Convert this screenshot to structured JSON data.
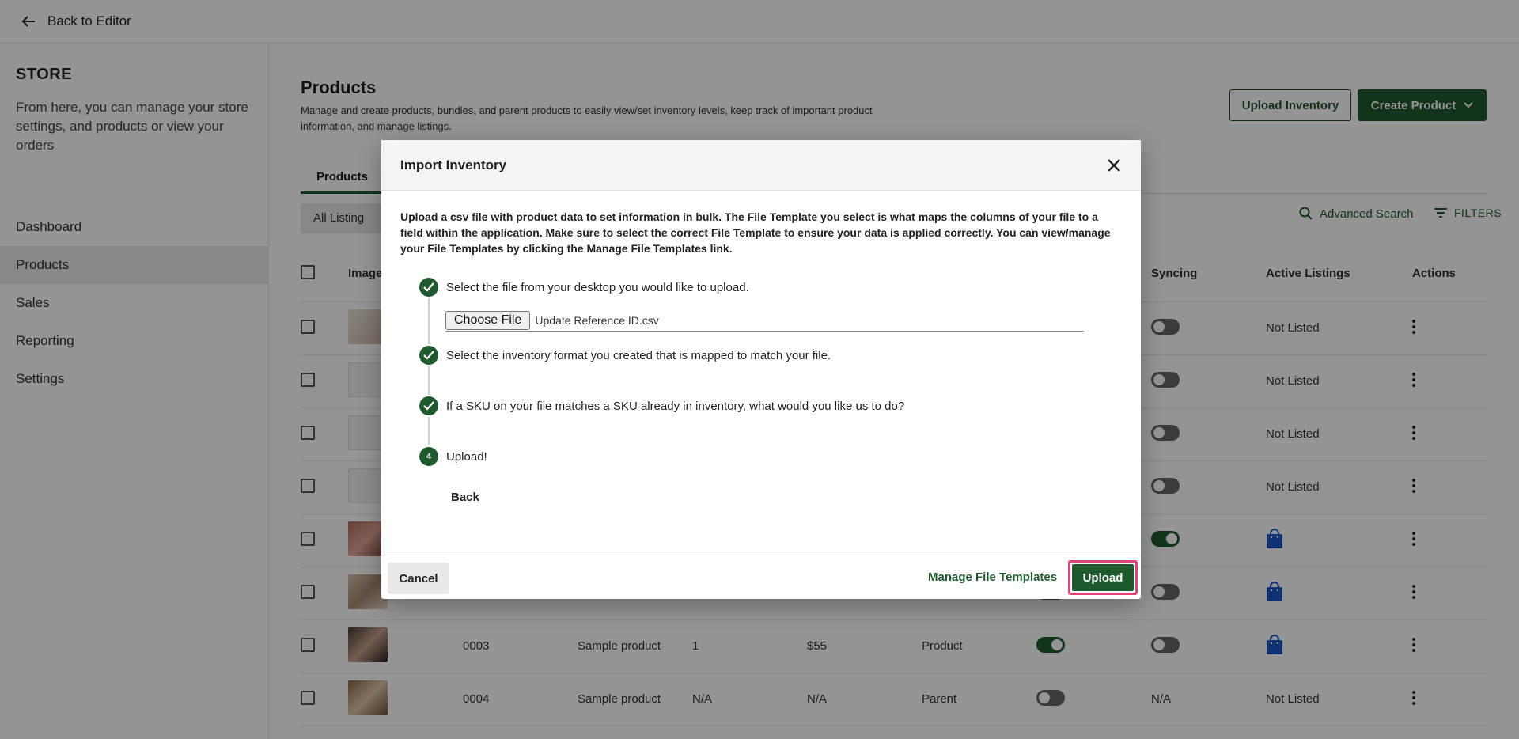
{
  "topbar": {
    "back_label": "Back to Editor"
  },
  "sidebar": {
    "title": "STORE",
    "description": "From here, you can manage your store settings, and products or view your orders",
    "items": [
      {
        "label": "Dashboard"
      },
      {
        "label": "Products",
        "active": true
      },
      {
        "label": "Sales"
      },
      {
        "label": "Reporting"
      },
      {
        "label": "Settings"
      }
    ]
  },
  "main": {
    "title": "Products",
    "description": "Manage and create products, bundles, and parent products to easily view/set inventory levels, keep track of important product information, and manage listings.",
    "upload_inventory_label": "Upload Inventory",
    "create_product_label": "Create Product",
    "tab_label": "Products",
    "filter_chip_label": "All Listing",
    "advanced_search_label": "Advanced Search",
    "filters_label": "FILTERS",
    "table": {
      "headers": {
        "image": "Image",
        "syncing": "Syncing",
        "active_listings": "Active Listings",
        "actions": "Actions"
      },
      "rows": [
        {
          "sku": "",
          "name": "",
          "qty": "",
          "price": "",
          "type": "",
          "active_listing": "Not Listed"
        },
        {
          "sku": "",
          "name": "",
          "qty": "",
          "price": "",
          "type": "",
          "active_listing": "Not Listed"
        },
        {
          "sku": "",
          "name": "",
          "qty": "",
          "price": "",
          "type": "",
          "active_listing": "Not Listed"
        },
        {
          "sku": "",
          "name": "",
          "qty": "",
          "price": "",
          "type": "",
          "active_listing": "Not Listed"
        },
        {
          "sku": "",
          "name": "",
          "qty": "",
          "price": "",
          "type": "",
          "active_listing": ""
        },
        {
          "sku": "",
          "name": "",
          "qty": "",
          "price": "",
          "type": "",
          "active_listing": ""
        },
        {
          "sku": "0003",
          "name": "Sample product",
          "qty": "1",
          "price": "$55",
          "type": "Product",
          "active_listing": ""
        },
        {
          "sku": "0004",
          "name": "Sample product",
          "qty": "N/A",
          "price": "N/A",
          "type": "Parent",
          "syncing_text": "N/A",
          "active_listing": "Not Listed"
        }
      ]
    }
  },
  "modal": {
    "title": "Import Inventory",
    "intro": "Upload a csv file with product data to set information in bulk. The File Template you select is what maps the columns of your file to a field within the application. Make sure to select the correct File Template to ensure your data is applied correctly. You can view/manage your File Templates by clicking the Manage File Templates link.",
    "steps": [
      {
        "label": "Select the file from your desktop you would like to upload."
      },
      {
        "label": "Select the inventory format you created that is mapped to match your file."
      },
      {
        "label": "If a SKU on your file matches a SKU already in inventory, what would you like us to do?"
      },
      {
        "label": "Upload!",
        "number": "4"
      }
    ],
    "choose_file_label": "Choose File",
    "file_name": "Update Reference ID.csv",
    "back_label": "Back",
    "cancel_label": "Cancel",
    "manage_templates_label": "Manage File Templates",
    "upload_label": "Upload"
  },
  "colors": {
    "brand_green": "#1f5a2e",
    "highlight_pink": "#e0457b",
    "listing_blue": "#1a56c4"
  }
}
